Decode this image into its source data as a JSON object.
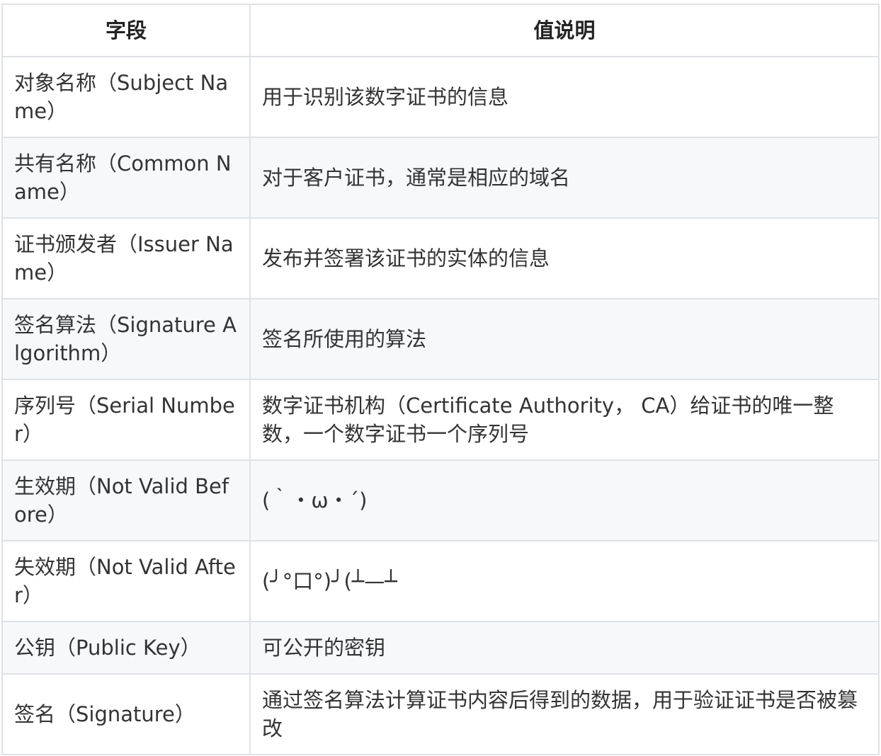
{
  "header": {
    "field": "字段",
    "description": "值说明"
  },
  "rows": [
    {
      "field": "对象名称（Subject Name）",
      "description": "用于识别该数字证书的信息"
    },
    {
      "field": "共有名称（Common Name）",
      "description": "对于客户证书，通常是相应的域名"
    },
    {
      "field": "证书颁发者（Issuer Name）",
      "description": "发布并签署该证书的实体的信息"
    },
    {
      "field": "签名算法（Signature Algorithm）",
      "description": "签名所使用的算法"
    },
    {
      "field": "序列号（Serial Number）",
      "description": "数字证书机构（Certificate Authority， CA）给证书的唯一整数，一个数字证书一个序列号"
    },
    {
      "field": "生效期（Not Valid Before）",
      "description": "(｀・ω・´)"
    },
    {
      "field": "失效期（Not Valid After）",
      "description": "(╯°口°)╯(┴—┴"
    },
    {
      "field": "公钥（Public Key）",
      "description": "可公开的密钥"
    },
    {
      "field": "签名（Signature）",
      "description": "通过签名算法计算证书内容后得到的数据，用于验证证书是否被篡改"
    }
  ],
  "colors": {
    "border": "#dfe2e5",
    "stripe": "#f6f8fa",
    "text": "#333333"
  }
}
